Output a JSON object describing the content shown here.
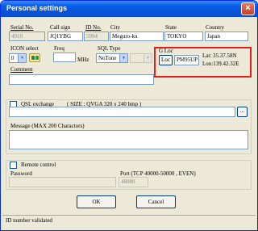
{
  "window": {
    "title": "Personal settings",
    "close_glyph": "×"
  },
  "station": {
    "serial_label": "Serial No.",
    "serial_value": "4910",
    "callsign_label": "Call sign",
    "callsign_value": "JQ1YBG",
    "idno_label": "ID No.",
    "idno_value": "5994",
    "city_label": "City",
    "city_value": "Meguro-ku",
    "state_label": "State",
    "state_value": "TOKYO",
    "country_label": "Country",
    "country_value": "Japan"
  },
  "icon_select": {
    "label": "ICON select",
    "value": "0"
  },
  "freq": {
    "label": "Freq",
    "unit": "MHz",
    "value": ""
  },
  "sql": {
    "label": "SQL Type",
    "value": "NoTone"
  },
  "gloc": {
    "label": "G Loc",
    "loc_button": "Loc",
    "grid_value": "PM95UP",
    "lat": "Lat: 35.37.58N",
    "lon": "Lon:139.42.32E"
  },
  "comment": {
    "label": "Comment",
    "value": ""
  },
  "qsl": {
    "label": "QSL exchange",
    "size_note": "( SIZE : QVGA 320 x 240 bmp )",
    "browse_button": "...",
    "message_label": "Message (MAX 200 Charactors)",
    "message_value": ""
  },
  "remote": {
    "label": "Remote control",
    "password_label": "Password",
    "password_value": "",
    "port_label": "Port (TCP 40000-50000 , EVEN)",
    "port_value": "48080"
  },
  "buttons": {
    "ok": "OK",
    "cancel": "Cancel"
  },
  "status": {
    "text": "ID number validated"
  },
  "colors": {
    "highlight": "#e11d1d",
    "titlebar": "#0a5ee8",
    "dialog_bg": "#ece9d8"
  }
}
